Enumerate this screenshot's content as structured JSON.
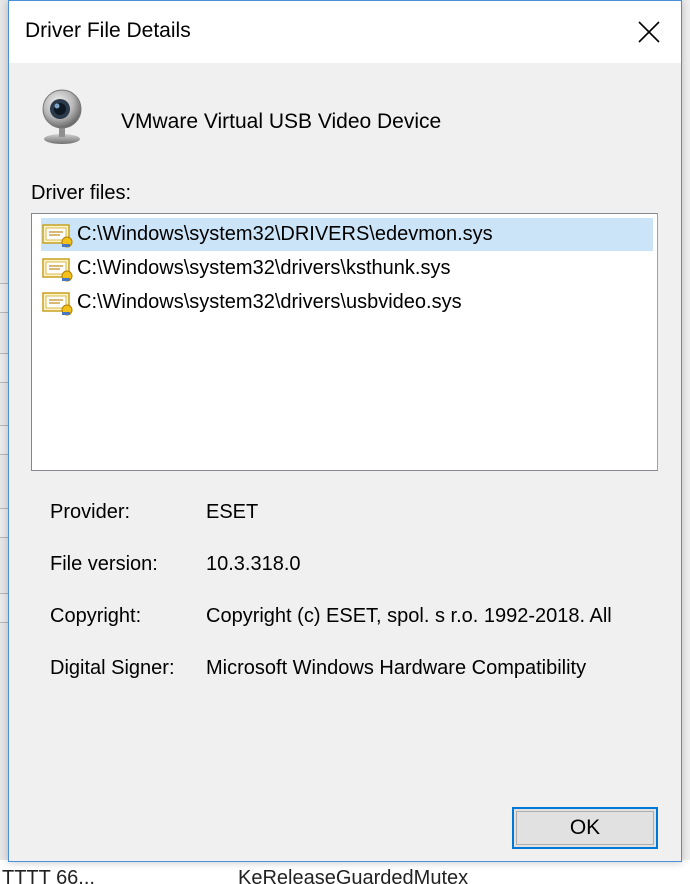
{
  "background": {
    "bottom_text_left": "TTTT 66...",
    "bottom_text_right": "KeReleaseGuardedMutex"
  },
  "dialog": {
    "title": "Driver File Details",
    "close_icon": "close-icon",
    "device_icon": "webcam-icon",
    "device_name": "VMware Virtual USB Video Device",
    "files_label": "Driver files:",
    "files": [
      {
        "path": "C:\\Windows\\system32\\DRIVERS\\edevmon.sys",
        "selected": true,
        "icon": "driver-file-icon"
      },
      {
        "path": "C:\\Windows\\system32\\drivers\\ksthunk.sys",
        "selected": false,
        "icon": "driver-file-icon"
      },
      {
        "path": "C:\\Windows\\system32\\drivers\\usbvideo.sys",
        "selected": false,
        "icon": "driver-file-icon"
      }
    ],
    "details": {
      "provider_label": "Provider:",
      "provider_value": "ESET",
      "file_version_label": "File version:",
      "file_version_value": "10.3.318.0",
      "copyright_label": "Copyright:",
      "copyright_value": "Copyright (c) ESET, spol. s r.o. 1992-2018. All",
      "digital_signer_label": "Digital Signer:",
      "digital_signer_value": "Microsoft Windows Hardware Compatibility"
    },
    "ok_label": "OK"
  },
  "colors": {
    "selection": "#cce4f7",
    "accent": "#0078d7",
    "window_bg": "#f0f0f0"
  }
}
